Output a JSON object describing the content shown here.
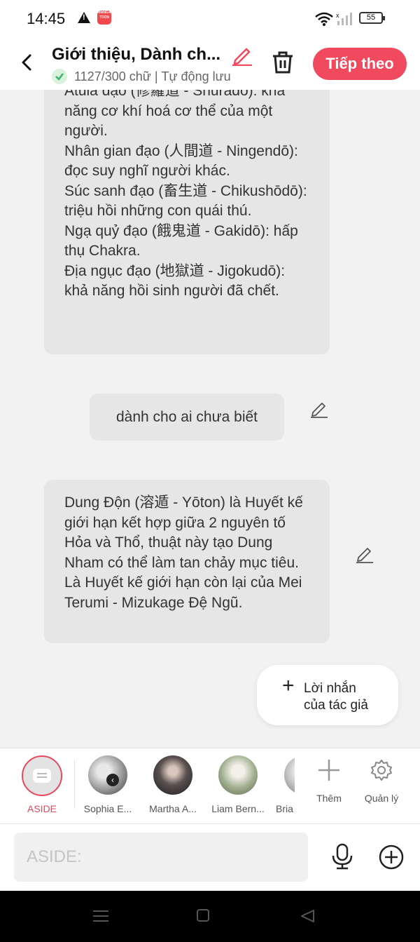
{
  "status": {
    "time": "14:45",
    "app_badge": "MANGA TOON",
    "battery": "55"
  },
  "header": {
    "title": "Giới thiệu, Dành ch...",
    "word_count": "1127/300 chữ",
    "autosave": "Tự động lưu",
    "next_label": "Tiếp theo"
  },
  "messages": [
    {
      "text": "Atula đạo (修羅道 - Shuradō): khả năng cơ khí hoá cơ thể của một người.\nNhân gian đạo (人間道 - Ningendō): đọc suy nghĩ người khác.\nSúc sanh đạo (畜生道 - Chikushōdō): triệu hồi những con quái thú.\nNgạ quỷ đạo (餓鬼道 - Gakidō): hấp thụ Chakra.\nĐịa ngục đạo (地獄道 - Jigokudō): khả năng hồi sinh người đã chết."
    },
    {
      "text": "dành cho ai chưa biết"
    },
    {
      "text": "Dung Độn (溶遁 - Yōton) là Huyết kế giới hạn kết hợp giữa 2 nguyên tố Hỏa và Thổ, thuật này tạo Dung Nham có thể làm tan chảy mục tiêu. Là Huyết kế giới hạn còn lại của Mei Terumi - Mizukage Đệ Ngũ."
    }
  ],
  "author_note": {
    "label": "Lời nhắn\ncủa tác giả"
  },
  "characters": [
    {
      "name": "ASIDE"
    },
    {
      "name": "Sophia E..."
    },
    {
      "name": "Martha A..."
    },
    {
      "name": "Liam Bern..."
    },
    {
      "name": "Bria"
    }
  ],
  "tools": {
    "add_label": "Thêm",
    "manage_label": "Quản lý"
  },
  "composer": {
    "placeholder": "ASIDE:"
  },
  "colors": {
    "accent": "#f14a5e",
    "bubble": "#e6e6e6",
    "background": "#f2f2f2"
  }
}
